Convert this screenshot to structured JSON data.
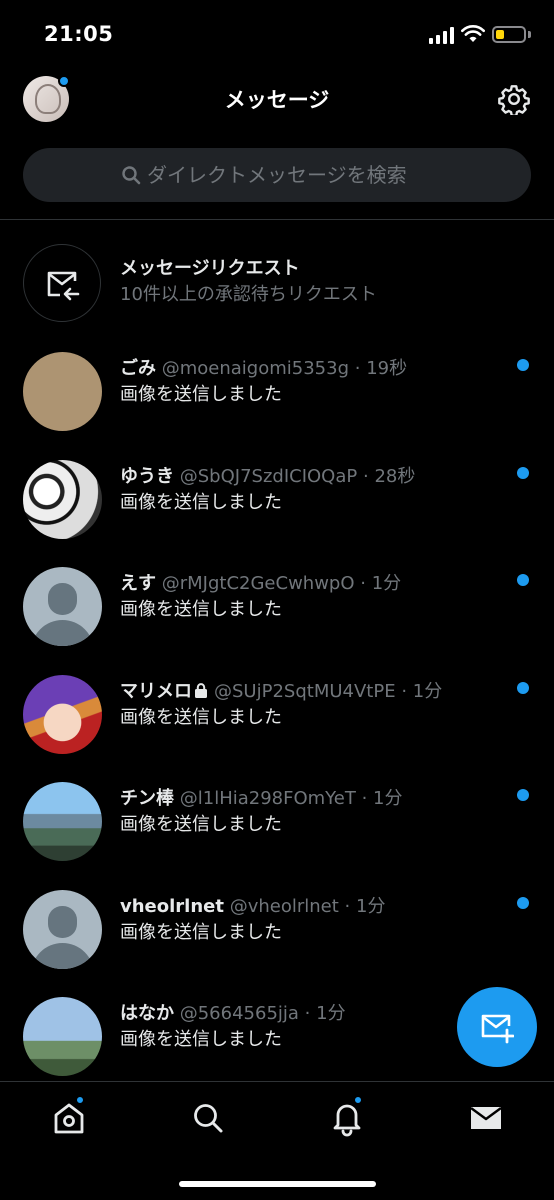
{
  "status": {
    "time": "21:05",
    "battery_level": 0.3
  },
  "header": {
    "title": "メッセージ"
  },
  "search": {
    "placeholder": "ダイレクトメッセージを検索"
  },
  "requests": {
    "title": "メッセージリクエスト",
    "subtitle": "10件以上の承認待ちリクエスト"
  },
  "conversations": [
    {
      "name": "ごみ",
      "handle": "@moenaigomi5353g",
      "time": "19秒",
      "preview": "画像を送信しました",
      "unread": true,
      "locked": false,
      "avatar": "tan"
    },
    {
      "name": "ゆうき",
      "handle": "@SbQJ7SzdICIOQaP",
      "time": "28秒",
      "preview": "画像を送信しました",
      "unread": true,
      "locked": false,
      "avatar": "manga"
    },
    {
      "name": "えす",
      "handle": "@rMJgtC2GeCwhwpO",
      "time": "1分",
      "preview": "画像を送信しました",
      "unread": true,
      "locked": false,
      "avatar": "default"
    },
    {
      "name": "マリメロ",
      "handle": "@SUjP2SqtMU4VtPE",
      "time": "1分",
      "preview": "画像を送信しました",
      "unread": true,
      "locked": true,
      "avatar": "anime"
    },
    {
      "name": "チン棒",
      "handle": "@l1lHia298FOmYeT",
      "time": "1分",
      "preview": "画像を送信しました",
      "unread": true,
      "locked": false,
      "avatar": "buddha"
    },
    {
      "name": "vheolrlnet",
      "handle": "@vheolrlnet",
      "time": "1分",
      "preview": "画像を送信しました",
      "unread": true,
      "locked": false,
      "avatar": "default"
    },
    {
      "name": "はなか",
      "handle": "@5664565jja",
      "time": "1分",
      "preview": "画像を送信しました",
      "unread": false,
      "locked": false,
      "avatar": "sky"
    }
  ],
  "separator": "·",
  "colors": {
    "accent": "#1d9bf0",
    "background": "#000000",
    "secondary_text": "#71767b"
  },
  "nav": [
    {
      "icon": "home-icon",
      "badge": true
    },
    {
      "icon": "search-icon",
      "badge": false
    },
    {
      "icon": "bell-icon",
      "badge": true
    },
    {
      "icon": "mail-icon",
      "badge": false,
      "active": true
    }
  ]
}
